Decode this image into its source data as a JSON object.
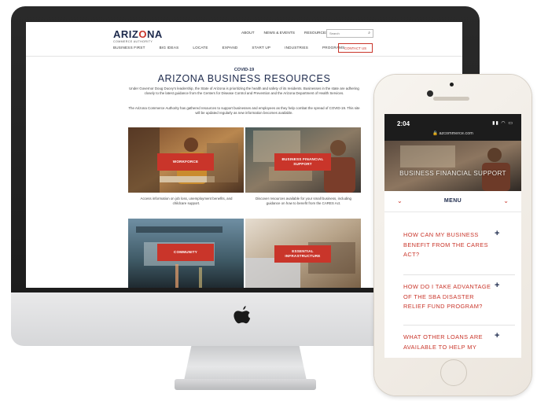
{
  "desktop_site": {
    "logo": {
      "word_a": "ARIZ",
      "word_o": "O",
      "word_b": "NA",
      "sub": "COMMERCE AUTHORITY"
    },
    "top_links": [
      "ABOUT",
      "NEWS & EVENTS",
      "RESOURCES"
    ],
    "search": {
      "placeholder": "Search"
    },
    "nav": [
      "BUSINESS FIRST",
      "BIG IDEAS",
      "LOCATE",
      "EXPAND",
      "START UP",
      "INDUSTRIES",
      "PROGRAMS"
    ],
    "contact_button": "CONTACT US",
    "eyebrow": "COVID-19",
    "heading": "ARIZONA BUSINESS RESOURCES",
    "intro_1": "Under Governor Doug Ducey's leadership, the State of Arizona is prioritizing the health and safety of its residents. Businesses in the state are adhering closely to the latest guidance from the Centers for Disease Control and Prevention and the Arizona Department of Health Services.",
    "intro_2": "The Arizona Commerce Authority has gathered resources to support businesses and employees as they help combat the spread of COVID-19. This site will be updated regularly as new information becomes available.",
    "tiles": [
      {
        "label": "WORKFORCE",
        "caption": "Access information on job loss, unemployment benefits, and childcare support."
      },
      {
        "label": "BUSINESS FINANCIAL SUPPORT",
        "caption": "Discover resources available for your small business, including guidance on how to benefit from the CARES Act."
      },
      {
        "label": "COMMUNITY",
        "caption": ""
      },
      {
        "label": "ESSENTIAL INFRASTRUCTURE",
        "caption": ""
      }
    ]
  },
  "mobile_site": {
    "time": "2:04",
    "status_icons": "▮▮ ◠ ▭",
    "url": "🔒 azcommerce.com",
    "hero_title": "BUSINESS FINANCIAL SUPPORT",
    "menu_label": "MENU",
    "faqs": [
      {
        "question": "HOW CAN MY BUSINESS BENEFIT FROM THE CARES ACT?",
        "toggle": "+"
      },
      {
        "question": "HOW DO I TAKE ADVANTAGE OF THE SBA DISASTER RELIEF FUND PROGRAM?",
        "toggle": "+"
      },
      {
        "question": "WHAT OTHER LOANS ARE AVAILABLE TO HELP MY",
        "toggle": "+"
      }
    ]
  },
  "colors": {
    "brand_red": "#c9352a",
    "brand_navy": "#1d2a4c"
  }
}
